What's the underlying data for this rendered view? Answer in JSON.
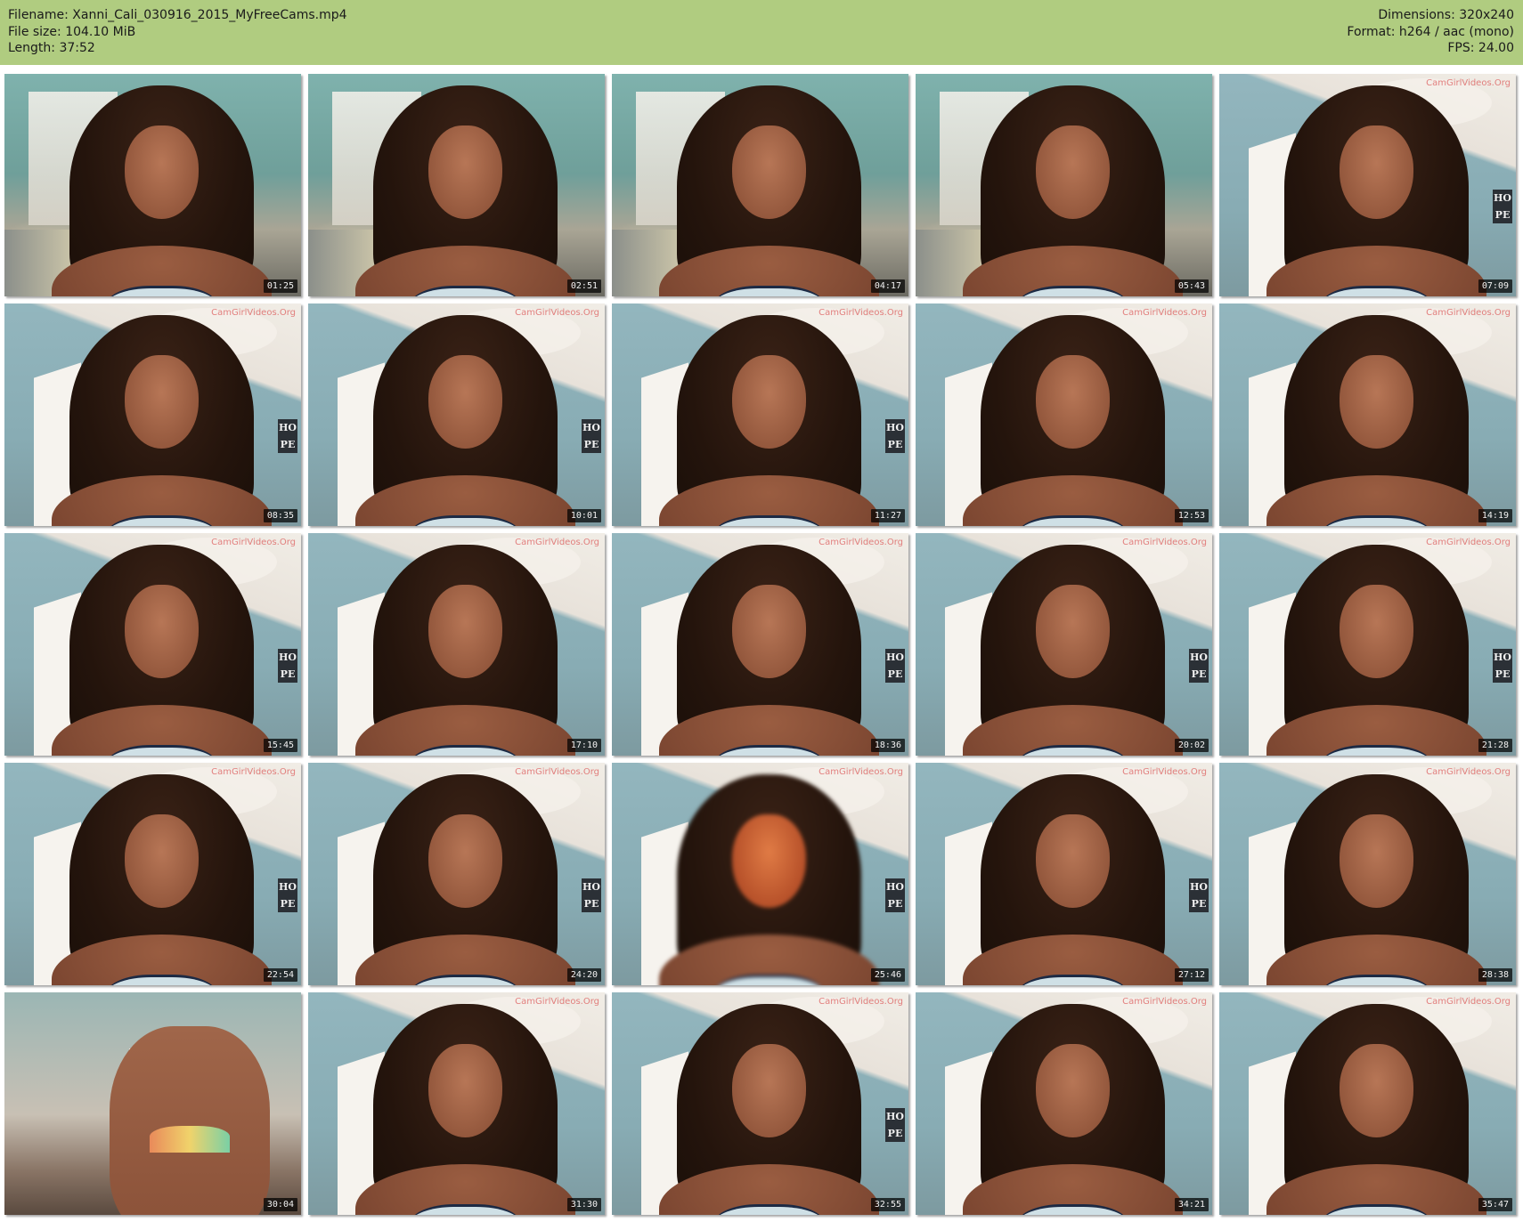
{
  "header": {
    "left": [
      "Filename: Xanni_Cali_030916_2015_MyFreeCams.mp4",
      "File size: 104.10 MiB",
      "Length: 37:52"
    ],
    "right": [
      "Dimensions: 320x240",
      "Format: h264 / aac (mono)",
      "FPS: 24.00"
    ],
    "background_color": "#b0cc80"
  },
  "watermark_text": "CamGirlVideos.Org",
  "hope_sign": [
    "HO",
    "PE"
  ],
  "thumbnails": [
    {
      "time": "01:25",
      "scene": "A",
      "watermark": false
    },
    {
      "time": "02:51",
      "scene": "A",
      "watermark": false
    },
    {
      "time": "04:17",
      "scene": "A",
      "watermark": false
    },
    {
      "time": "05:43",
      "scene": "A",
      "watermark": false
    },
    {
      "time": "07:09",
      "scene": "B",
      "watermark": true,
      "hope": true
    },
    {
      "time": "08:35",
      "scene": "B",
      "watermark": true,
      "hope": true
    },
    {
      "time": "10:01",
      "scene": "B",
      "watermark": true,
      "hope": true
    },
    {
      "time": "11:27",
      "scene": "B",
      "watermark": true,
      "hope": true
    },
    {
      "time": "12:53",
      "scene": "B",
      "watermark": true
    },
    {
      "time": "14:19",
      "scene": "B",
      "watermark": true
    },
    {
      "time": "15:45",
      "scene": "B",
      "watermark": true,
      "hope": true
    },
    {
      "time": "17:10",
      "scene": "B",
      "watermark": true
    },
    {
      "time": "18:36",
      "scene": "B",
      "watermark": true,
      "hope": true
    },
    {
      "time": "20:02",
      "scene": "B",
      "watermark": true,
      "hope": true
    },
    {
      "time": "21:28",
      "scene": "B",
      "watermark": true,
      "hope": true
    },
    {
      "time": "22:54",
      "scene": "B",
      "watermark": true,
      "hope": true
    },
    {
      "time": "24:20",
      "scene": "B",
      "watermark": true,
      "hope": true
    },
    {
      "time": "25:46",
      "scene": "B",
      "watermark": true,
      "hope": true,
      "blur": true
    },
    {
      "time": "27:12",
      "scene": "B",
      "watermark": true,
      "hope": true
    },
    {
      "time": "28:38",
      "scene": "B",
      "watermark": true
    },
    {
      "time": "30:04",
      "scene": "C",
      "watermark": false,
      "back": true
    },
    {
      "time": "31:30",
      "scene": "B",
      "watermark": true
    },
    {
      "time": "32:55",
      "scene": "B",
      "watermark": true,
      "hope": true
    },
    {
      "time": "34:21",
      "scene": "B",
      "watermark": true
    },
    {
      "time": "35:47",
      "scene": "B",
      "watermark": true
    }
  ]
}
